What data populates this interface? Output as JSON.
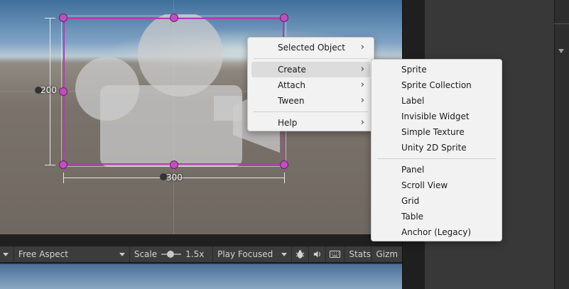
{
  "scene": {
    "height_label": "200",
    "width_label": "300"
  },
  "toolbar": {
    "aspect": "Free Aspect",
    "scale_label": "Scale",
    "scale_value": "1.5x",
    "play_mode": "Play Focused",
    "stats_label": "Stats",
    "gizmos_label": "Gizm"
  },
  "context_menu": {
    "items": [
      {
        "label": "Selected Object",
        "submenu": true
      },
      {
        "label": "Create",
        "submenu": true
      },
      {
        "label": "Attach",
        "submenu": true
      },
      {
        "label": "Tween",
        "submenu": true
      },
      {
        "label": "Help",
        "submenu": true
      }
    ],
    "chevron": "›"
  },
  "create_submenu": {
    "items": [
      "Sprite",
      "Sprite Collection",
      "Label",
      "Invisible Widget",
      "Simple Texture",
      "Unity 2D Sprite",
      "Panel",
      "Scroll View",
      "Grid",
      "Table",
      "Anchor (Legacy)"
    ]
  },
  "colors": {
    "selection": "#b53ab4",
    "menu_bg": "#f2f2f2",
    "menu_highlight": "#dcdcdc"
  }
}
